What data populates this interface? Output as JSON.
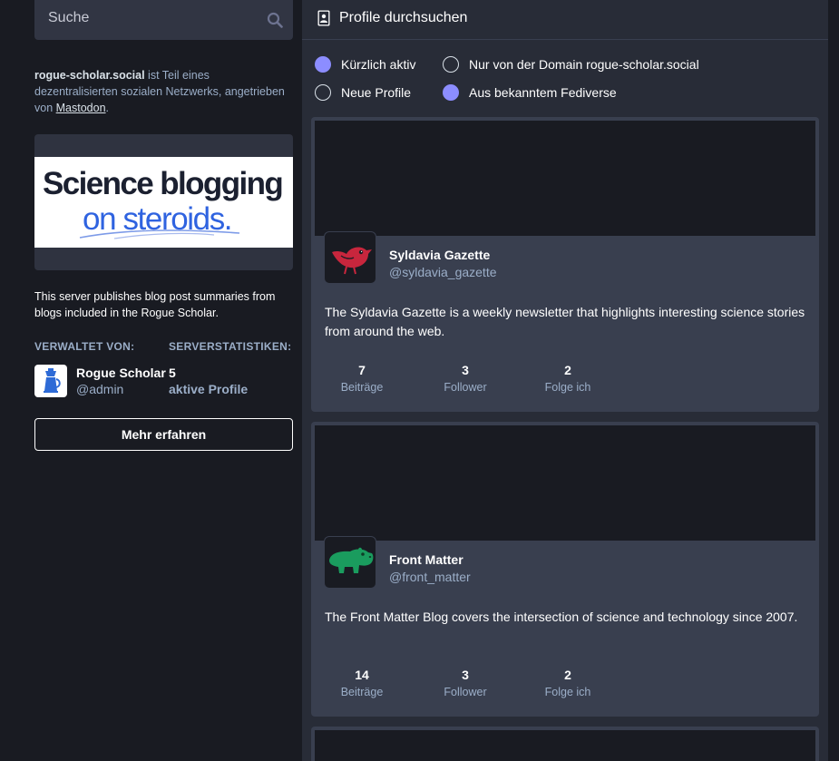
{
  "search": {
    "placeholder": "Suche"
  },
  "about": {
    "domain": "rogue-scholar.social",
    "text_after_domain": " ist Teil eines dezentralisierten sozialen Netzwerks, angetrieben von ",
    "link": "Mastodon",
    "suffix": "."
  },
  "banner": {
    "line1": "Science blogging",
    "line2": "on steroids."
  },
  "server_description": "This server publishes blog post summaries from blogs included in the Rogue Scholar.",
  "administered_by": {
    "heading": "VERWALTET VON:",
    "name": "Rogue Scholar",
    "handle": "@admin"
  },
  "server_stats": {
    "heading": "SERVERSTATISTIKEN:",
    "value": "5",
    "label": "aktive Profile"
  },
  "learn_more_label": "Mehr erfahren",
  "column": {
    "icon": "address-book-icon",
    "title": "Profile durchsuchen"
  },
  "filters": [
    {
      "label": "Kürzlich aktiv",
      "checked": true
    },
    {
      "label": "Nur von der Domain rogue-scholar.social",
      "checked": false
    },
    {
      "label": "Neue Profile",
      "checked": false
    },
    {
      "label": "Aus bekanntem Fediverse",
      "checked": true
    }
  ],
  "accent_color": "#8c8dff",
  "profiles": [
    {
      "name": "Syldavia Gazette",
      "handle": "@syldavia_gazette",
      "bio": "The Syldavia Gazette is a weekly newsletter that highlights interesting science stories from around the web.",
      "avatar_icon": "red-bird-icon",
      "stats": [
        {
          "value": "7",
          "label": "Beiträge"
        },
        {
          "value": "3",
          "label": "Follower"
        },
        {
          "value": "2",
          "label": "Folge ich"
        }
      ]
    },
    {
      "name": "Front Matter",
      "handle": "@front_matter",
      "bio": "The Front Matter Blog covers the intersection of science and technology since 2007.",
      "avatar_icon": "green-hippo-icon",
      "stats": [
        {
          "value": "14",
          "label": "Beiträge"
        },
        {
          "value": "3",
          "label": "Follower"
        },
        {
          "value": "2",
          "label": "Folge ich"
        }
      ]
    }
  ]
}
